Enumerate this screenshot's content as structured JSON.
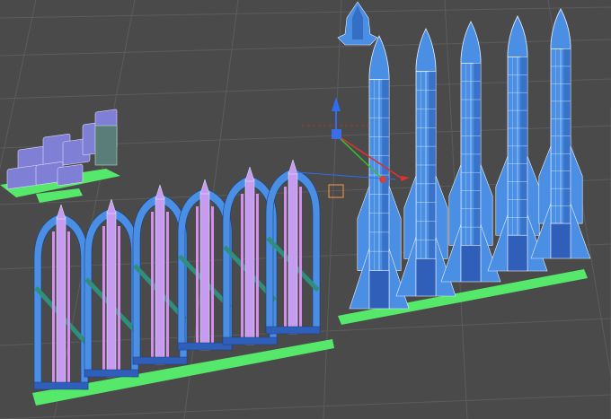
{
  "viewport": {
    "view": "3d-viewport",
    "background_color": "#4a4a4a",
    "grid_color": "#5c5c5c",
    "colors": {
      "model_fill": "#4a8fe3",
      "model_dark": "#2f5fb8",
      "model_highlight": "#c79bf0",
      "wireframe": "#e6f0ff",
      "support_pink": "#d58ef0",
      "support_teal": "#2e8f7d",
      "build_plate": "#55e86a",
      "gizmo_x": "#e03030",
      "gizmo_y": "#30c030",
      "gizmo_z": "#2f6cf0",
      "gizmo_center": "#3a6ee8",
      "bbox_orange": "#ff9a3a"
    }
  },
  "scene": {
    "objects": [
      {
        "name": "small-rocket-model",
        "icon": "rocket-icon",
        "count": 1
      },
      {
        "name": "mech-parts-group",
        "icon": "mech-parts-icon",
        "count": 1
      },
      {
        "name": "rocket-with-supports-row",
        "icon": "rocket-icon",
        "count": 6
      },
      {
        "name": "tall-rocket-row",
        "icon": "rocket-icon",
        "count": 5
      }
    ],
    "gizmo": {
      "type": "move-transform-gizmo",
      "axes": [
        "x",
        "y",
        "z"
      ]
    }
  }
}
